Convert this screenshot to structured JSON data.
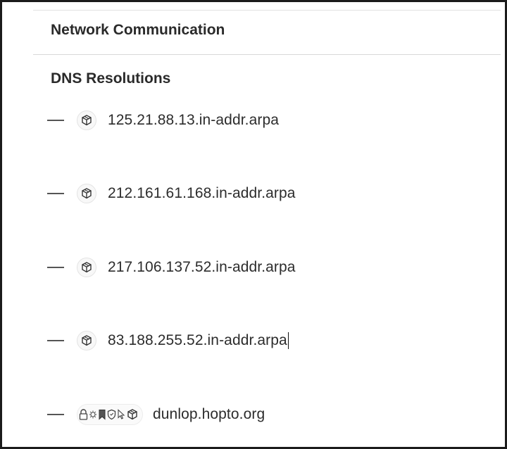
{
  "network": {
    "section_title": "Network Communication",
    "subsection_title": "DNS Resolutions"
  },
  "dns_resolutions": [
    {
      "hostname": "125.21.88.13.in-addr.arpa",
      "icons": [
        "cube-icon"
      ]
    },
    {
      "hostname": "212.161.61.168.in-addr.arpa",
      "icons": [
        "cube-icon"
      ]
    },
    {
      "hostname": "217.106.137.52.in-addr.arpa",
      "icons": [
        "cube-icon"
      ]
    },
    {
      "hostname": "83.188.255.52.in-addr.arpa",
      "icons": [
        "cube-icon"
      ]
    },
    {
      "hostname": "dunlop.hopto.org",
      "icons": [
        "lock-icon",
        "virus-icon",
        "bookmark-icon",
        "shield-icon",
        "cursor-icon",
        "cube-icon"
      ]
    }
  ],
  "colors": {
    "border": "#1b1b1b",
    "text": "#2c2c2c",
    "divider": "#d8d8d8"
  }
}
